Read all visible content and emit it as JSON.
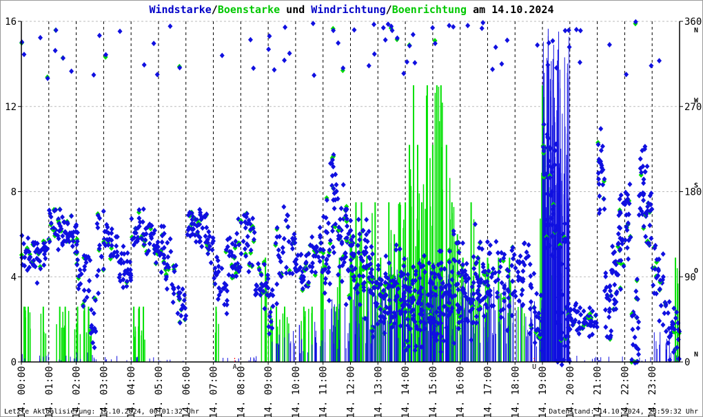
{
  "chart_data": {
    "type": "scatter",
    "title_parts": [
      {
        "text": "Windstarke",
        "color": "#0000c8"
      },
      {
        "text": "/",
        "color": "#000000"
      },
      {
        "text": "Boenstarke",
        "color": "#00c800"
      },
      {
        "text": " und ",
        "color": "#000000"
      },
      {
        "text": "Windrichtung",
        "color": "#0000c8"
      },
      {
        "text": "/",
        "color": "#000000"
      },
      {
        "text": "Boenrichtung",
        "color": "#00c800"
      },
      {
        "text": " am 14.10.2024",
        "color": "#000000"
      }
    ],
    "colors": {
      "wind": "#1010e0",
      "gust": "#00e000",
      "marker": "#ff0000",
      "grid": "#bbbbbb"
    },
    "x_range_hours": [
      0,
      24
    ],
    "x_ticks": [
      "14. 00:00",
      "14. 01:00",
      "14. 02:00",
      "14. 03:00",
      "14. 04:00",
      "14. 05:00",
      "14. 06:00",
      "14. 07:00",
      "14. 08:00",
      "14. 09:00",
      "14. 10:00",
      "14. 11:00",
      "14. 12:00",
      "14. 13:00",
      "14. 14:00",
      "14. 15:00",
      "14. 16:00",
      "14. 17:00",
      "14. 18:00",
      "14. 19:00",
      "14. 20:00",
      "14. 21:00",
      "14. 22:00",
      "14. 23:00"
    ],
    "y_left": {
      "range": [
        0,
        16
      ],
      "ticks": [
        "0",
        "4",
        "8",
        "12",
        "16"
      ]
    },
    "y_right": {
      "range": [
        0,
        360
      ],
      "ticks": [
        "0",
        "90",
        "180",
        "270",
        "360"
      ],
      "compass": [
        "N",
        "O",
        "S",
        "W",
        "N"
      ]
    },
    "markers": [
      {
        "label": "A",
        "hour": 7.78
      },
      {
        "label": "U",
        "hour": 18.7
      }
    ],
    "direction_every_15min_deg": [
      115,
      110,
      105,
      120,
      145,
      140,
      140,
      135,
      100,
      95,
      30,
      120,
      130,
      120,
      100,
      95,
      135,
      140,
      130,
      125,
      120,
      100,
      75,
      60,
      150,
      145,
      140,
      125,
      90,
      85,
      110,
      120,
      135,
      125,
      90,
      80,
      60,
      110,
      125,
      105,
      100,
      95,
      110,
      115,
      110,
      175,
      150,
      125,
      120,
      105,
      90,
      80,
      75,
      80,
      70,
      75,
      70,
      65,
      75,
      70,
      70,
      65,
      75,
      80,
      75,
      80,
      90,
      85,
      95,
      90,
      80,
      85,
      100,
      95,
      60,
      40,
      200,
      170,
      80,
      60,
      50,
      43,
      43,
      43,
      200,
      60,
      100,
      130,
      145,
      35,
      180,
      160,
      100,
      70,
      40,
      30
    ],
    "direction_spread_per_hour_deg": [
      25,
      20,
      40,
      20,
      20,
      30,
      20,
      30,
      30,
      40,
      25,
      60,
      50,
      50,
      55,
      55,
      50,
      40,
      40,
      90,
      15,
      50,
      50,
      40
    ],
    "wind_speed_max_per_hour": [
      0.5,
      0.3,
      0.5,
      0.3,
      0.3,
      0.2,
      0,
      0.2,
      0.3,
      1.5,
      2,
      3,
      4,
      4.5,
      5,
      5,
      4.5,
      4,
      3,
      16,
      0.3,
      0.3,
      0.3,
      1.5
    ],
    "gusts": [
      [
        0.1,
        2.6
      ],
      [
        0.25,
        2.6
      ],
      [
        0.8,
        2.6
      ],
      [
        1.4,
        2.6
      ],
      [
        1.6,
        2.6
      ],
      [
        2.05,
        2.6
      ],
      [
        2.3,
        2.6
      ],
      [
        2.45,
        2.6
      ],
      [
        4.1,
        2.6
      ],
      [
        4.3,
        2.6
      ],
      [
        4.45,
        2.6
      ],
      [
        7.1,
        2.6
      ],
      [
        8.9,
        4.9
      ],
      [
        9.1,
        2.6
      ],
      [
        9.3,
        2.6
      ],
      [
        9.6,
        2.6
      ],
      [
        10.3,
        2.6
      ],
      [
        10.6,
        2.6
      ],
      [
        11,
        4.9
      ],
      [
        11.4,
        2.6
      ],
      [
        11.6,
        4.9
      ],
      [
        12,
        6
      ],
      [
        12.2,
        7.5
      ],
      [
        12.4,
        7.5
      ],
      [
        12.6,
        5
      ],
      [
        12.9,
        7.5
      ],
      [
        13.1,
        4.9
      ],
      [
        13.4,
        7.5
      ],
      [
        13.6,
        6
      ],
      [
        13.8,
        7.5
      ],
      [
        14,
        7.5
      ],
      [
        14.15,
        10.2
      ],
      [
        14.3,
        13
      ],
      [
        14.45,
        10.2
      ],
      [
        14.6,
        7.5
      ],
      [
        14.8,
        13
      ],
      [
        15,
        10.2
      ],
      [
        15.15,
        13
      ],
      [
        15.3,
        13
      ],
      [
        15.5,
        10.2
      ],
      [
        15.7,
        7.5
      ],
      [
        15.9,
        6
      ],
      [
        16.1,
        4.9
      ],
      [
        16.4,
        7.5
      ],
      [
        16.7,
        4.9
      ],
      [
        17,
        4.9
      ],
      [
        17.4,
        4.9
      ],
      [
        17.8,
        4.9
      ],
      [
        18.25,
        2.6
      ],
      [
        19,
        13
      ],
      [
        19.1,
        10.2
      ],
      [
        19.3,
        4.9
      ],
      [
        19.6,
        2.6
      ],
      [
        23.85,
        4.9
      ]
    ],
    "footer_left": "Letzte Aktualisierung: 15.10.2024, 00:01:32 Uhr",
    "footer_right": "Datenstand: 14.10.2024, 23:59:32 Uhr"
  }
}
